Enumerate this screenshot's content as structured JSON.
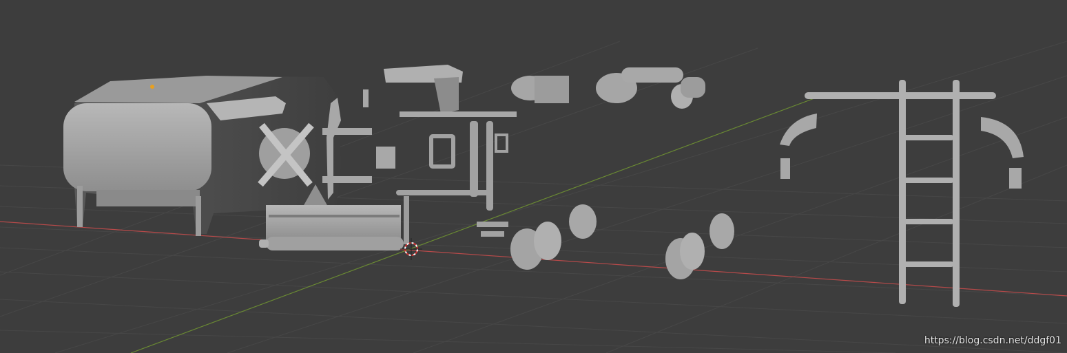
{
  "viewport": {
    "background": "#3d3d3d",
    "grid_color": "#474747",
    "x_axis_color": "#b84a4a",
    "y_axis_color": "#6a8a33",
    "mesh_color": "#a6a6a6",
    "origin_color": "#e8a020"
  },
  "scene_objects": [
    "hood-body",
    "headlight-cross",
    "exhaust-block",
    "cab-panel",
    "pipe-assembly",
    "motor-part",
    "cylinder-assembly",
    "wheel-set-front",
    "wheel-set-rear",
    "fender-left",
    "fender-right",
    "ladder-rail"
  ],
  "cursor_3d": "3d-cursor-icon",
  "watermark": "https://blog.csdn.net/ddgf01"
}
